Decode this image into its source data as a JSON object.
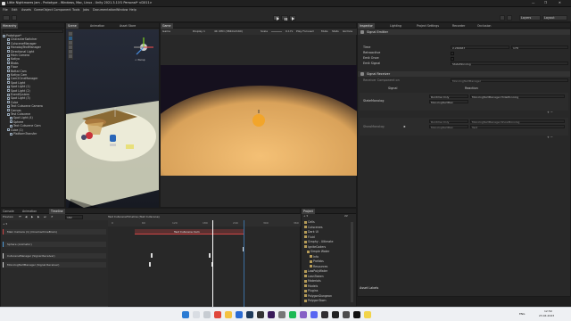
{
  "window": {
    "title": "Little Nightmares Jam - Prototype - Windows, Mac, Linux - Unity 2021.3.11f1 Personal* <DX11>",
    "controls": [
      "—",
      "❐",
      "✕"
    ]
  },
  "menu": [
    "File",
    "Edit",
    "Assets",
    "GameObject",
    "Component",
    "Tools",
    "Jobs",
    "Documentation",
    "Window",
    "Help"
  ],
  "toolbar": {
    "account": "▲",
    "layers": "Layers",
    "layout": "Layout"
  },
  "hierarchy": {
    "tab": "Hierarchy",
    "scene": "Prototype*",
    "items": [
      {
        "label": "CharacterSwitcher",
        "indent": 2,
        "sel": false
      },
      {
        "label": "CutsceneManager",
        "indent": 2,
        "sel": false
      },
      {
        "label": "MonologTextManager",
        "indent": 2,
        "sel": false
      },
      {
        "label": "Directional Light",
        "indent": 2,
        "sel": false
      },
      {
        "label": "Main Camera",
        "indent": 2,
        "sel": false
      },
      {
        "label": "Katiya",
        "indent": 2,
        "sel": false
      },
      {
        "label": "Blobs",
        "indent": 2,
        "sel": false
      },
      {
        "label": "Floor",
        "indent": 2,
        "sel": false
      },
      {
        "label": "Bottal Cam",
        "indent": 2,
        "sel": false
      },
      {
        "label": "Katiya Cam",
        "indent": 2,
        "sel": false
      },
      {
        "label": "Cam2CineManager",
        "indent": 2,
        "sel": false
      },
      {
        "label": "Spot Light",
        "indent": 2,
        "sel": false
      },
      {
        "label": "Spot Light (1)",
        "indent": 2,
        "sel": false
      },
      {
        "label": "Spot Light (2)",
        "indent": 2,
        "sel": false
      },
      {
        "label": "EventSystem",
        "indent": 2,
        "sel": false
      },
      {
        "label": "Spot Light (3)",
        "indent": 2,
        "sel": false
      },
      {
        "label": "Cube",
        "indent": 2,
        "sel": false
      },
      {
        "label": "Text Cutscene Camera",
        "indent": 2,
        "sel": false
      },
      {
        "label": "Canvas",
        "indent": 2,
        "sel": false
      },
      {
        "label": "Test Cutscene",
        "indent": 2,
        "sel": false
      },
      {
        "label": "Spot Light (4)",
        "indent": 3,
        "sel": false
      },
      {
        "label": "Sphere",
        "indent": 3,
        "sel": false
      },
      {
        "label": "Text Cutscene Cam",
        "indent": 3,
        "sel": false
      },
      {
        "label": "Cube (1)",
        "indent": 2,
        "sel": false
      },
      {
        "label": "PlatformTransfer",
        "indent": 3,
        "sel": false
      }
    ]
  },
  "scene_tabs": [
    "Scene",
    "Animation",
    "Asset Store"
  ],
  "scene_persp": "< Persp",
  "game": {
    "tab": "Game",
    "mode": "Game",
    "display": "Display 1",
    "resolution": "4K UHD (3840x2160)",
    "scale_label": "Scale",
    "scale": "0.17x",
    "play_focused": "Play Focused",
    "stats": [
      "Mute",
      "Stats",
      "Gizmos"
    ]
  },
  "inspector": {
    "tabs": [
      "Inspector",
      "Lighting",
      "Project Settings",
      "Recorder",
      "Occlusion"
    ],
    "signal_emitter": {
      "header": "Signal Emitter",
      "time_label": "Time",
      "time_value": "2.266667",
      "frame_value": "178",
      "retroactive": "Retroactive",
      "emit_once": "Emit Once",
      "emit_signal_label": "Emit Signal",
      "emit_signal_value": "StateMonolog"
    },
    "signal_receiver": {
      "header": "Signal Receiver",
      "component_label": "Receiver Component on",
      "component_value": "MonologTextManager",
      "col_signal": "Signal",
      "col_reaction": "Reaction",
      "rows": [
        {
          "signal": "StateMonolog",
          "runtime": "Runtime Only",
          "func": "MonologTextManager.HideMonolog",
          "obj": "MonologTextMan"
        },
        {
          "signal": "ShowMonolog",
          "runtime": "Runtime Only",
          "func": "MonologTextManager.ShowMonolog",
          "obj": "MonologTextMan"
        }
      ],
      "extra_func": "Text"
    },
    "asset_labels": "Asset Labels"
  },
  "timeline": {
    "tabs": [
      "Console",
      "Animation",
      "Timeline"
    ],
    "preview": "Preview",
    "frame": "182",
    "asset": "Test CutsceneTimeline (Test Cutscene)",
    "ruler": [
      "0",
      "60",
      "120",
      "180",
      "240",
      "300",
      "360"
    ],
    "tracks": [
      {
        "name": "Main Camera (1) (CinemachineBrain)",
        "color": "#cf4545"
      },
      {
        "name": "Sphere (Animator)",
        "color": "#4f9bd8"
      },
      {
        "name": "CutsceneManager (Signal Receiver)",
        "color": "#d8d8d8"
      },
      {
        "name": "MonologTextManager (Signal Receiver)",
        "color": "#d8d8d8"
      }
    ],
    "clip_label": "Test Cutscene Cam"
  },
  "project": {
    "tab": "Project",
    "count": "22",
    "items": [
      {
        "label": "Cells",
        "indent": 1
      },
      {
        "label": "Cutscenes",
        "indent": 1
      },
      {
        "label": "Dark UI",
        "indent": 1
      },
      {
        "label": "Fluid",
        "indent": 1
      },
      {
        "label": "Graphy - Ultimate",
        "indent": 1
      },
      {
        "label": "IgniteCoders",
        "indent": 1
      },
      {
        "label": "Simple Water",
        "indent": 2
      },
      {
        "label": "Info",
        "indent": 3
      },
      {
        "label": "Prefabs",
        "indent": 3
      },
      {
        "label": "Resources",
        "indent": 3
      },
      {
        "label": "LowPolyWater",
        "indent": 1
      },
      {
        "label": "LeanTween",
        "indent": 1
      },
      {
        "label": "Materials",
        "indent": 1
      },
      {
        "label": "Models",
        "indent": 1
      },
      {
        "label": "Plugins",
        "indent": 1
      },
      {
        "label": "PolygonDungeon",
        "indent": 1
      },
      {
        "label": "PolygonTown",
        "indent": 1
      }
    ]
  },
  "taskbar": {
    "search_placeholder": "Search",
    "time": "12:59",
    "date": "23.04.2023",
    "lang": "ENG"
  },
  "colors": {
    "selection": "#2c5d87",
    "playhead": "#ffffff",
    "accent": "#4f9bd8"
  }
}
